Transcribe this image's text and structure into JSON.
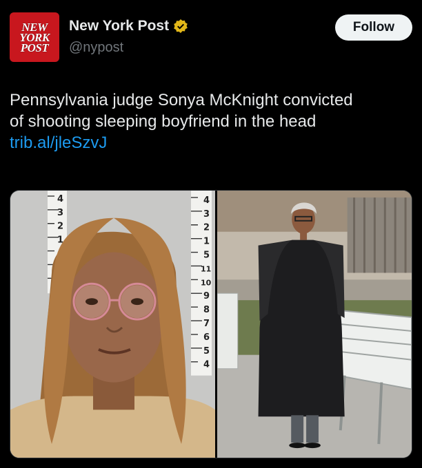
{
  "account": {
    "logo_lines": [
      "NEW",
      "YORK",
      "POST"
    ],
    "display_name": "New York Post",
    "handle": "@nypost",
    "verified_badge": "verified-gold-badge-icon",
    "follow_label": "Follow"
  },
  "post": {
    "text_line1": "Pennsylvania judge Sonya McKnight convicted",
    "text_line2": "of shooting sleeping boyfriend in the head",
    "link": "trib.al/jleSzvJ"
  },
  "media": {
    "left_photo": {
      "height_chart_top": [
        "4",
        "3",
        "2",
        "1"
      ],
      "height_chart_right": [
        "4",
        "3",
        "2",
        "1",
        "5",
        "11",
        "10",
        "9",
        "8",
        "7",
        "6",
        "5",
        "4"
      ]
    }
  },
  "colors": {
    "background": "#000000",
    "text": "#e7e9ea",
    "secondary_text": "#71767b",
    "link": "#1d9bf0",
    "logo_red": "#c8171e",
    "badge_gold": "#e2b719"
  }
}
